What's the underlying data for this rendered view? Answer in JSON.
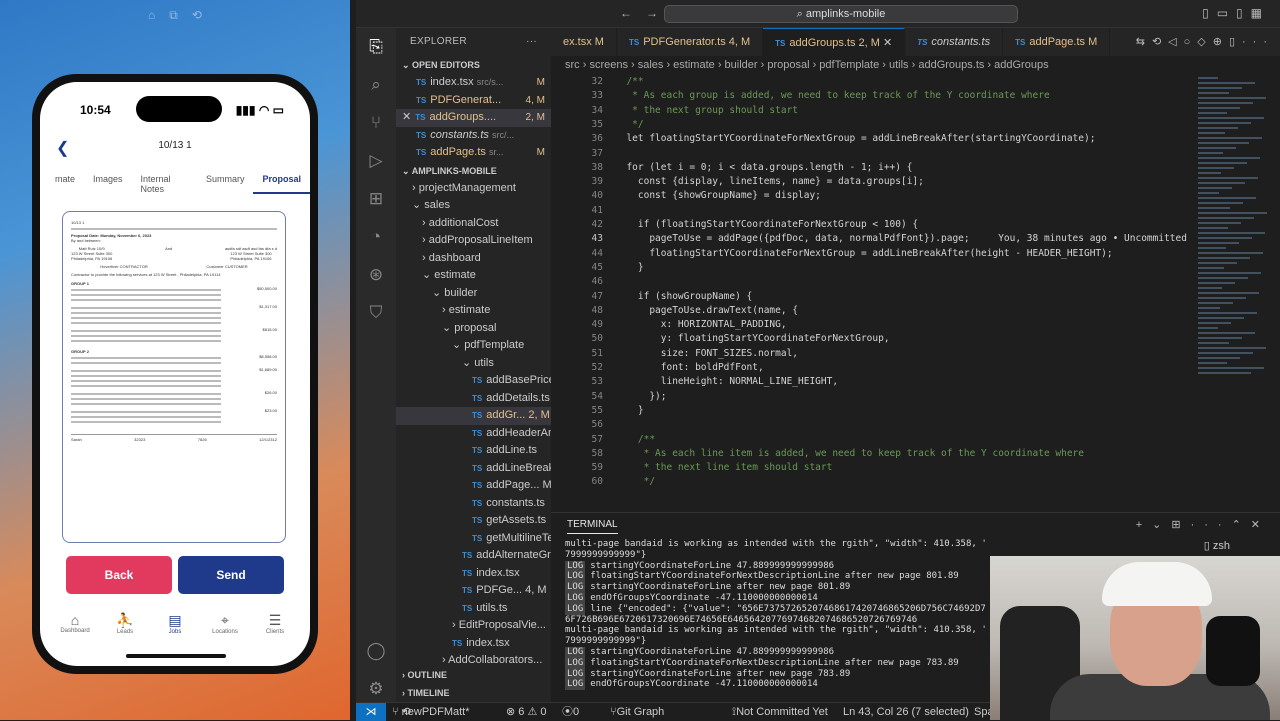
{
  "phone": {
    "time": "10:54",
    "page_title": "10/13 1",
    "tabs": [
      "mate",
      "Images",
      "Internal Notes",
      "Summary",
      "Proposal"
    ],
    "doc": {
      "header": "10/13 1",
      "date": "Proposal Date: Monday, November 6, 2023",
      "by": "By and between:",
      "left_name": "Matt Ruiz 10/9",
      "left_addr": "123 W Street Suite 300",
      "left_city": "Philadelphia, PA 19106",
      "and": "And",
      "right_name": "asdfa sdf asdf asd fas dfa s d",
      "right_addr": "123 W Street Suite 300",
      "right_city": "Philadelphia, PA 19106",
      "contractor": "Hoverfiver CONTRACTOR",
      "customer": "Customer CUSTOMER",
      "services": "Contractor to provide the following services at 123 W Street , Philadelphia, PA 19114",
      "group1": "GROUP 1",
      "group2": "GROUP 2",
      "prices": [
        "$50,500.00",
        "$1,317.00",
        "$815.00",
        "$8,558.00",
        "$1,689.00",
        "$26.00",
        "$23.00"
      ],
      "footer": [
        "Sarah",
        "32323",
        "7826",
        "12/1/2312"
      ]
    },
    "back_label": "Back",
    "send_label": "Send",
    "nav": [
      "Dashboard",
      "Leads",
      "Jobs",
      "Locations",
      "Clients"
    ]
  },
  "vscode": {
    "search": "amplinks-mobile",
    "explorer_title": "EXPLORER",
    "open_editors_title": "OPEN EDITORS",
    "open_editors": [
      {
        "name": "index.tsx",
        "path": "src/s...",
        "badge": "M"
      },
      {
        "name": "PDFGenerat...",
        "path": "",
        "badge": "4, M"
      },
      {
        "name": "addGroups....",
        "path": "",
        "badge": "2, M"
      },
      {
        "name": "constants.ts",
        "path": "src/...",
        "badge": ""
      },
      {
        "name": "addPage.ts",
        "path": "sr...",
        "badge": "M"
      }
    ],
    "project_title": "AMPLINKS-MOBILE",
    "tree": [
      {
        "name": "projectManagement",
        "indent": 1,
        "arrow": "›",
        "ts": false
      },
      {
        "name": "sales",
        "indent": 1,
        "arrow": "⌄",
        "ts": false
      },
      {
        "name": "additionalCost",
        "indent": 2,
        "arrow": "›",
        "ts": false
      },
      {
        "name": "addProposalLineItem",
        "indent": 2,
        "arrow": "›",
        "ts": false
      },
      {
        "name": "dashboard",
        "indent": 2,
        "arrow": "›",
        "ts": false
      },
      {
        "name": "estimate",
        "indent": 2,
        "arrow": "⌄",
        "ts": false
      },
      {
        "name": "builder",
        "indent": 3,
        "arrow": "⌄",
        "ts": false
      },
      {
        "name": "estimate",
        "indent": 4,
        "arrow": "›",
        "ts": false
      },
      {
        "name": "proposal",
        "indent": 4,
        "arrow": "⌄",
        "ts": false
      },
      {
        "name": "pdfTemplate",
        "indent": 5,
        "arrow": "⌄",
        "ts": false
      },
      {
        "name": "utils",
        "indent": 6,
        "arrow": "⌄",
        "ts": false
      },
      {
        "name": "addBasePrice...",
        "indent": 7,
        "arrow": "",
        "ts": true
      },
      {
        "name": "addDetails.ts",
        "indent": 7,
        "arrow": "",
        "ts": true
      },
      {
        "name": "addGr... 2, M",
        "indent": 7,
        "arrow": "",
        "ts": true
      },
      {
        "name": "addHeaderAn...",
        "indent": 7,
        "arrow": "",
        "ts": true
      },
      {
        "name": "addLine.ts",
        "indent": 7,
        "arrow": "",
        "ts": true
      },
      {
        "name": "addLineBreak...",
        "indent": 7,
        "arrow": "",
        "ts": true
      },
      {
        "name": "addPage... M",
        "indent": 7,
        "arrow": "",
        "ts": true
      },
      {
        "name": "constants.ts",
        "indent": 7,
        "arrow": "",
        "ts": true
      },
      {
        "name": "getAssets.ts",
        "indent": 7,
        "arrow": "",
        "ts": true
      },
      {
        "name": "getMultilineTe...",
        "indent": 7,
        "arrow": "",
        "ts": true
      },
      {
        "name": "addAlternateGr...",
        "indent": 6,
        "arrow": "",
        "ts": true
      },
      {
        "name": "index.tsx",
        "indent": 6,
        "arrow": "",
        "ts": true
      },
      {
        "name": "PDFGe... 4, M",
        "indent": 6,
        "arrow": "",
        "ts": true
      },
      {
        "name": "utils.ts",
        "indent": 6,
        "arrow": "",
        "ts": true
      },
      {
        "name": "EditProposalVie...",
        "indent": 5,
        "arrow": "›",
        "ts": false
      },
      {
        "name": "index.tsx",
        "indent": 5,
        "arrow": "",
        "ts": true
      },
      {
        "name": "AddCollaborators...",
        "indent": 4,
        "arrow": "›",
        "ts": false
      }
    ],
    "outline": "OUTLINE",
    "timeline": "TIMELINE",
    "tabs": [
      {
        "label": "ex.tsx M",
        "active": false
      },
      {
        "label": "PDFGenerator.ts 4, M",
        "active": false
      },
      {
        "label": "addGroups.ts 2, M",
        "active": true
      },
      {
        "label": "constants.ts",
        "active": false
      },
      {
        "label": "addPage.ts M",
        "active": false
      }
    ],
    "breadcrumb": "src › screens › sales › estimate › builder › proposal › pdfTemplate › utils › addGroups.ts › addGroups",
    "code": [
      {
        "n": "32",
        "t": "  /**"
      },
      {
        "n": "33",
        "t": "   * As each group is added, we need to keep track of the Y coordinate where"
      },
      {
        "n": "34",
        "t": "   * the next group should start"
      },
      {
        "n": "35",
        "t": "   */"
      },
      {
        "n": "36",
        "t": "  let floatingStartYCoordinateForNextGroup = addLineBreakAfter(startingYCoordinate);"
      },
      {
        "n": "37",
        "t": ""
      },
      {
        "n": "38",
        "t": "  for (let i = 0; i < data.groups.length - 1; i++) {"
      },
      {
        "n": "39",
        "t": "    const {display, lineItems, name} = data.groups[i];"
      },
      {
        "n": "40",
        "t": "    const {showGroupName} = display;"
      },
      {
        "n": "41",
        "t": ""
      },
      {
        "n": "42",
        "t": "    if (floatingStartYCoordinateForNextGroup < 100) {"
      },
      {
        "n": "43",
        "t": "      pageToUse = addPage({pdfDoc, data, normalPdfFont}).page;     You, 38 minutes ago • Uncommitted"
      },
      {
        "n": "44",
        "t": "      floatingStartYCoordinateForNextGroup = addLineBreakAfter(height - HEADER_HEIGHT);"
      },
      {
        "n": "45",
        "t": "    }"
      },
      {
        "n": "46",
        "t": ""
      },
      {
        "n": "47",
        "t": "    if (showGroupName) {"
      },
      {
        "n": "48",
        "t": "      pageToUse.drawText(name, {"
      },
      {
        "n": "49",
        "t": "        x: HORIZONTAL_PADDING,"
      },
      {
        "n": "50",
        "t": "        y: floatingStartYCoordinateForNextGroup,"
      },
      {
        "n": "51",
        "t": "        size: FONT_SIZES.normal,"
      },
      {
        "n": "52",
        "t": "        font: boldPdfFont,"
      },
      {
        "n": "53",
        "t": "        lineHeight: NORMAL_LINE_HEIGHT,"
      },
      {
        "n": "54",
        "t": "      });"
      },
      {
        "n": "55",
        "t": "    }"
      },
      {
        "n": "56",
        "t": ""
      },
      {
        "n": "57",
        "t": "    /**"
      },
      {
        "n": "58",
        "t": "     * As each line item is added, we need to keep track of the Y coordinate where"
      },
      {
        "n": "59",
        "t": "     * the next line item should start"
      },
      {
        "n": "60",
        "t": "     */"
      }
    ],
    "terminal_title": "TERMINAL",
    "shell": "zsh",
    "terminal": [
      {
        "log": false,
        "t": " multi-page bandaid is working as intended with the rgith\", \"width\": 410.358, \"x\": 41.960999999999984, \"y\": 42.2"
      },
      {
        "log": false,
        "t": "7999999999999\"}"
      },
      {
        "log": true,
        "t": "startingYCoordinateForLine 47.889999999999986"
      },
      {
        "log": true,
        "t": "floatingStartYCoordinateForNextDescriptionLine after new page 801.89"
      },
      {
        "log": true,
        "t": "startingYCoordinateForLine after new page 801.89"
      },
      {
        "log": true,
        "t": "endOfGroupsYCoordinate -47.110000000000014"
      },
      {
        "log": true,
        "t": "line {\"encoded\": {\"value\": \"656E73757265207468617420746865206D756C74692D70"
      },
      {
        "log": false,
        "t": "6F726B696E6720617320696E74656E64656420776974682074686520726769746"
      },
      {
        "log": false,
        "t": " multi-page bandaid is working as intended with the rgith\", \"width\": 410.358, \"x\":"
      },
      {
        "log": false,
        "t": "7999999999999\"}"
      },
      {
        "log": true,
        "t": "startingYCoordinateForLine 47.889999999999986"
      },
      {
        "log": true,
        "t": "floatingStartYCoordinateForNextDescriptionLine after new page 783.89"
      },
      {
        "log": true,
        "t": "startingYCoordinateForLine after new page 783.89"
      },
      {
        "log": true,
        "t": "endOfGroupsYCoordinate -47.110000000000014"
      }
    ],
    "status": {
      "branch": "newPDFMatt*",
      "problems": "⊗ 6 ⚠ 0",
      "ports": "0",
      "git_graph": "Git Graph",
      "commit": "Not Committed Yet",
      "cursor": "Ln 43, Col 26 (7 selected)",
      "spaces": "Spa"
    }
  }
}
